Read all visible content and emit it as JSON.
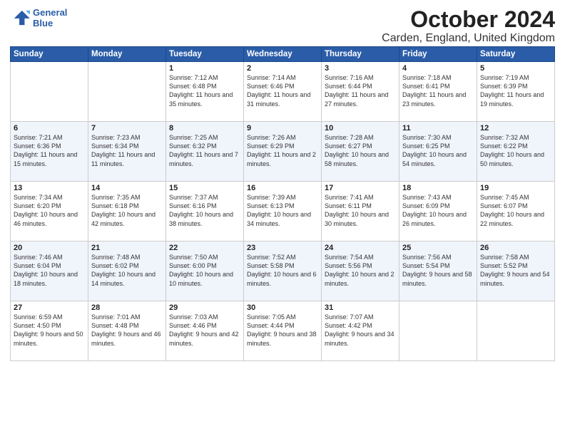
{
  "logo": {
    "line1": "General",
    "line2": "Blue"
  },
  "title": "October 2024",
  "location": "Carden, England, United Kingdom",
  "headers": [
    "Sunday",
    "Monday",
    "Tuesday",
    "Wednesday",
    "Thursday",
    "Friday",
    "Saturday"
  ],
  "weeks": [
    [
      {
        "day": "",
        "content": ""
      },
      {
        "day": "",
        "content": ""
      },
      {
        "day": "1",
        "content": "Sunrise: 7:12 AM\nSunset: 6:48 PM\nDaylight: 11 hours\nand 35 minutes."
      },
      {
        "day": "2",
        "content": "Sunrise: 7:14 AM\nSunset: 6:46 PM\nDaylight: 11 hours\nand 31 minutes."
      },
      {
        "day": "3",
        "content": "Sunrise: 7:16 AM\nSunset: 6:44 PM\nDaylight: 11 hours\nand 27 minutes."
      },
      {
        "day": "4",
        "content": "Sunrise: 7:18 AM\nSunset: 6:41 PM\nDaylight: 11 hours\nand 23 minutes."
      },
      {
        "day": "5",
        "content": "Sunrise: 7:19 AM\nSunset: 6:39 PM\nDaylight: 11 hours\nand 19 minutes."
      }
    ],
    [
      {
        "day": "6",
        "content": "Sunrise: 7:21 AM\nSunset: 6:36 PM\nDaylight: 11 hours\nand 15 minutes."
      },
      {
        "day": "7",
        "content": "Sunrise: 7:23 AM\nSunset: 6:34 PM\nDaylight: 11 hours\nand 11 minutes."
      },
      {
        "day": "8",
        "content": "Sunrise: 7:25 AM\nSunset: 6:32 PM\nDaylight: 11 hours\nand 7 minutes."
      },
      {
        "day": "9",
        "content": "Sunrise: 7:26 AM\nSunset: 6:29 PM\nDaylight: 11 hours\nand 2 minutes."
      },
      {
        "day": "10",
        "content": "Sunrise: 7:28 AM\nSunset: 6:27 PM\nDaylight: 10 hours\nand 58 minutes."
      },
      {
        "day": "11",
        "content": "Sunrise: 7:30 AM\nSunset: 6:25 PM\nDaylight: 10 hours\nand 54 minutes."
      },
      {
        "day": "12",
        "content": "Sunrise: 7:32 AM\nSunset: 6:22 PM\nDaylight: 10 hours\nand 50 minutes."
      }
    ],
    [
      {
        "day": "13",
        "content": "Sunrise: 7:34 AM\nSunset: 6:20 PM\nDaylight: 10 hours\nand 46 minutes."
      },
      {
        "day": "14",
        "content": "Sunrise: 7:35 AM\nSunset: 6:18 PM\nDaylight: 10 hours\nand 42 minutes."
      },
      {
        "day": "15",
        "content": "Sunrise: 7:37 AM\nSunset: 6:16 PM\nDaylight: 10 hours\nand 38 minutes."
      },
      {
        "day": "16",
        "content": "Sunrise: 7:39 AM\nSunset: 6:13 PM\nDaylight: 10 hours\nand 34 minutes."
      },
      {
        "day": "17",
        "content": "Sunrise: 7:41 AM\nSunset: 6:11 PM\nDaylight: 10 hours\nand 30 minutes."
      },
      {
        "day": "18",
        "content": "Sunrise: 7:43 AM\nSunset: 6:09 PM\nDaylight: 10 hours\nand 26 minutes."
      },
      {
        "day": "19",
        "content": "Sunrise: 7:45 AM\nSunset: 6:07 PM\nDaylight: 10 hours\nand 22 minutes."
      }
    ],
    [
      {
        "day": "20",
        "content": "Sunrise: 7:46 AM\nSunset: 6:04 PM\nDaylight: 10 hours\nand 18 minutes."
      },
      {
        "day": "21",
        "content": "Sunrise: 7:48 AM\nSunset: 6:02 PM\nDaylight: 10 hours\nand 14 minutes."
      },
      {
        "day": "22",
        "content": "Sunrise: 7:50 AM\nSunset: 6:00 PM\nDaylight: 10 hours\nand 10 minutes."
      },
      {
        "day": "23",
        "content": "Sunrise: 7:52 AM\nSunset: 5:58 PM\nDaylight: 10 hours\nand 6 minutes."
      },
      {
        "day": "24",
        "content": "Sunrise: 7:54 AM\nSunset: 5:56 PM\nDaylight: 10 hours\nand 2 minutes."
      },
      {
        "day": "25",
        "content": "Sunrise: 7:56 AM\nSunset: 5:54 PM\nDaylight: 9 hours\nand 58 minutes."
      },
      {
        "day": "26",
        "content": "Sunrise: 7:58 AM\nSunset: 5:52 PM\nDaylight: 9 hours\nand 54 minutes."
      }
    ],
    [
      {
        "day": "27",
        "content": "Sunrise: 6:59 AM\nSunset: 4:50 PM\nDaylight: 9 hours\nand 50 minutes."
      },
      {
        "day": "28",
        "content": "Sunrise: 7:01 AM\nSunset: 4:48 PM\nDaylight: 9 hours\nand 46 minutes."
      },
      {
        "day": "29",
        "content": "Sunrise: 7:03 AM\nSunset: 4:46 PM\nDaylight: 9 hours\nand 42 minutes."
      },
      {
        "day": "30",
        "content": "Sunrise: 7:05 AM\nSunset: 4:44 PM\nDaylight: 9 hours\nand 38 minutes."
      },
      {
        "day": "31",
        "content": "Sunrise: 7:07 AM\nSunset: 4:42 PM\nDaylight: 9 hours\nand 34 minutes."
      },
      {
        "day": "",
        "content": ""
      },
      {
        "day": "",
        "content": ""
      }
    ]
  ]
}
